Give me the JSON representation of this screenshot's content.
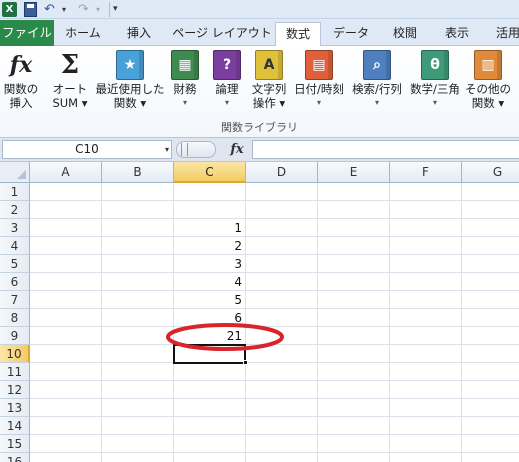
{
  "ribbon_tabs": [
    {
      "label": "ファイル"
    },
    {
      "label": "ホーム"
    },
    {
      "label": "挿入"
    },
    {
      "label": "ページ レイアウト"
    },
    {
      "label": "数式"
    },
    {
      "label": "データ"
    },
    {
      "label": "校閲"
    },
    {
      "label": "表示"
    },
    {
      "label": "活用"
    }
  ],
  "active_tab": "数式",
  "ribbon": {
    "buttons": [
      {
        "line1": "関数の",
        "line2": "挿入",
        "icon": "fx-icon"
      },
      {
        "line1": "オート",
        "line2": "SUM ▾",
        "icon": "sigma-icon"
      },
      {
        "line1": "最近使用した",
        "line2": "関数 ▾",
        "icon": "star-book-icon",
        "color": "#4aa0d8"
      },
      {
        "line1": "財務",
        "line2": "▾",
        "icon": "finance-book-icon",
        "color": "#3f8a4f"
      },
      {
        "line1": "論理",
        "line2": "▾",
        "icon": "question-book-icon",
        "color": "#7b3fa0"
      },
      {
        "line1": "文字列",
        "line2": "操作 ▾",
        "icon": "text-book-icon",
        "color": "#e0c23a"
      },
      {
        "line1": "日付/時刻",
        "line2": "▾",
        "icon": "calendar-book-icon",
        "color": "#e0603a"
      },
      {
        "line1": "検索/行列",
        "line2": "▾",
        "icon": "magnifier-book-icon",
        "color": "#4f7fbf"
      },
      {
        "line1": "数学/三角",
        "line2": "▾",
        "icon": "theta-book-icon",
        "color": "#3f9a7a"
      },
      {
        "line1": "その他の",
        "line2": "関数 ▾",
        "icon": "more-books-icon",
        "color": "#e08a3a"
      }
    ],
    "icon_glyphs": {
      "fx": "fx",
      "sigma": "Σ",
      "question": "?",
      "text": "A",
      "theta": "θ"
    },
    "group_label": "関数ライブラリ"
  },
  "formula_bar": {
    "name_box": "C10",
    "fx_label": "fx",
    "formula": ""
  },
  "sheet": {
    "columns": [
      "A",
      "B",
      "C",
      "D",
      "E",
      "F",
      "G"
    ],
    "rows": [
      "1",
      "2",
      "3",
      "4",
      "5",
      "6",
      "7",
      "8",
      "9",
      "10",
      "11",
      "12",
      "13",
      "14",
      "15",
      "16"
    ],
    "selected_column": "C",
    "selected_row": "10",
    "active_cell": "C10",
    "cells": [
      {
        "ref": "C3",
        "value": "1"
      },
      {
        "ref": "C4",
        "value": "2"
      },
      {
        "ref": "C5",
        "value": "3"
      },
      {
        "ref": "C6",
        "value": "4"
      },
      {
        "ref": "C7",
        "value": "5"
      },
      {
        "ref": "C8",
        "value": "6"
      },
      {
        "ref": "C9",
        "value": "21"
      }
    ]
  },
  "annotation": {
    "shape": "ellipse",
    "color": "#d9252a",
    "target_cell": "C9"
  }
}
